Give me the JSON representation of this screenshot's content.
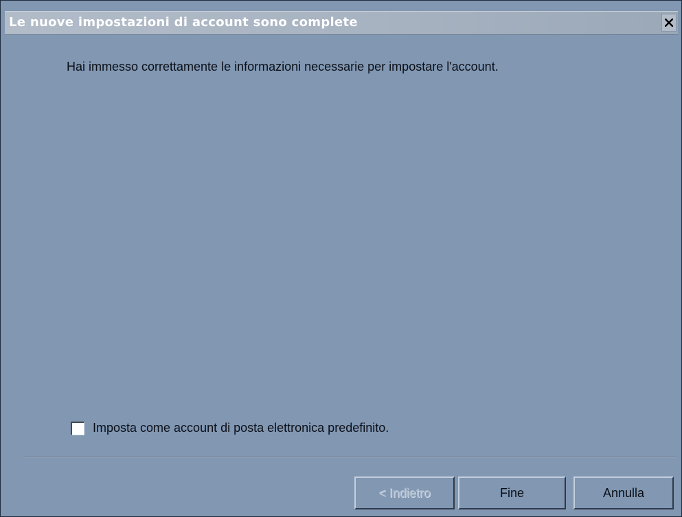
{
  "window": {
    "title": "Le nuove impostazioni di account sono complete",
    "close_glyph": "✕"
  },
  "main": {
    "message": "Hai immesso correttamente le informazioni necessarie per impostare l'account."
  },
  "default_account": {
    "label": "Imposta come account di posta elettronica predefinito.",
    "checked": false
  },
  "buttons": {
    "back": "< Indietro",
    "finish": "Fine",
    "cancel": "Annulla"
  },
  "colors": {
    "background": "#8197b2",
    "titlebar": "#a8b3c1",
    "text": "#0b0f18"
  }
}
